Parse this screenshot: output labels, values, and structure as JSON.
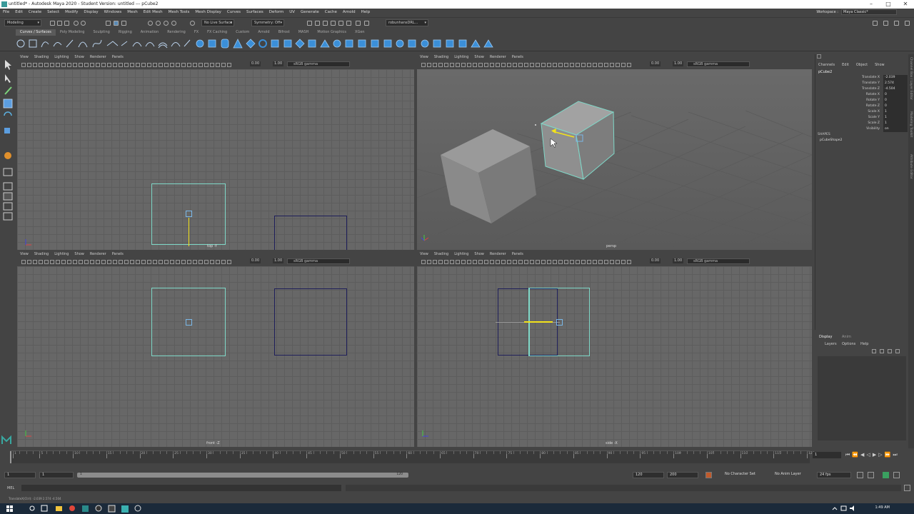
{
  "window": {
    "title": "untitled* - Autodesk Maya 2020 - Student Version: untitled  ---  pCube2",
    "controls": [
      "–",
      "□",
      "✕"
    ]
  },
  "menubar": [
    "File",
    "Edit",
    "Create",
    "Select",
    "Modify",
    "Display",
    "Windows",
    "Mesh",
    "Edit Mesh",
    "Mesh Tools",
    "Mesh Display",
    "Curves",
    "Surfaces",
    "Deform",
    "UV",
    "Generate",
    "Cache",
    "Arnold",
    "Help"
  ],
  "workspace": {
    "label": "Workspace :",
    "value": "Maya Classic*"
  },
  "statusline": {
    "mode": "Modeling",
    "live_surface": "No Live Surface",
    "symmetry": "Symmetry: Off",
    "user": "robunhansDRL..."
  },
  "shelf_tabs": [
    "Curves / Surfaces",
    "Poly Modeling",
    "Sculpting",
    "Rigging",
    "Animation",
    "Rendering",
    "FX",
    "FX Caching",
    "Custom",
    "Arnold",
    "Bifrost",
    "MASH",
    "Motion Graphics",
    "XGen"
  ],
  "viewport_menu": [
    "View",
    "Shading",
    "Lighting",
    "Show",
    "Renderer",
    "Panels"
  ],
  "viewport_fields": {
    "exposure": "0.00",
    "gamma": "1.00",
    "colorspace": "sRGB gamma"
  },
  "viewports": {
    "top": "top -Y",
    "persp": "persp",
    "front": "front -Z",
    "side": "side -X"
  },
  "channelbox": {
    "menu": [
      "Channels",
      "Edit",
      "Object",
      "Show"
    ],
    "object": "pCube2",
    "channels": [
      {
        "name": "Translate X",
        "value": "-2.039"
      },
      {
        "name": "Translate Y",
        "value": "2.574"
      },
      {
        "name": "Translate Z",
        "value": "-4.504"
      },
      {
        "name": "Rotate X",
        "value": "0"
      },
      {
        "name": "Rotate Y",
        "value": "0"
      },
      {
        "name": "Rotate Z",
        "value": "0"
      },
      {
        "name": "Scale X",
        "value": "1"
      },
      {
        "name": "Scale Y",
        "value": "1"
      },
      {
        "name": "Scale Z",
        "value": "1"
      },
      {
        "name": "Visibility",
        "value": "on"
      }
    ],
    "shapes_label": "SHAPES",
    "shape": "pCubeShape2"
  },
  "side_tabs": [
    "Channel Box / Layer Editor",
    "Modeling Toolkit",
    "Attribute Editor"
  ],
  "layers": {
    "tabs": [
      "Display",
      "Anim"
    ],
    "menu": [
      "Layers",
      "Options",
      "Help"
    ]
  },
  "timeline": {
    "ticks": [
      "1",
      "5",
      "10",
      "15",
      "20",
      "25",
      "30",
      "35",
      "40",
      "45",
      "50",
      "55",
      "60",
      "65",
      "70",
      "75",
      "80",
      "85",
      "90",
      "95",
      "100",
      "105",
      "110",
      "115",
      "120"
    ],
    "current_frame": "1"
  },
  "range": {
    "start": "1",
    "start_inner": "1",
    "bar_start": "1",
    "bar_end": "120",
    "end_inner": "120",
    "end": "200",
    "character_set": "No Character Set",
    "anim_layer": "No Anim Layer",
    "fps": "24 fps"
  },
  "cmdline": {
    "label": "MEL"
  },
  "helpline": {
    "text": "TranslateX(Ctrl):  -2.039        2.574        -4.504"
  },
  "taskbar": {
    "clock": "1:49 AM"
  },
  "colors": {
    "selection": "#7fd8c8",
    "manipulator": "#f2e21a",
    "viewport_bg": "#676767"
  }
}
